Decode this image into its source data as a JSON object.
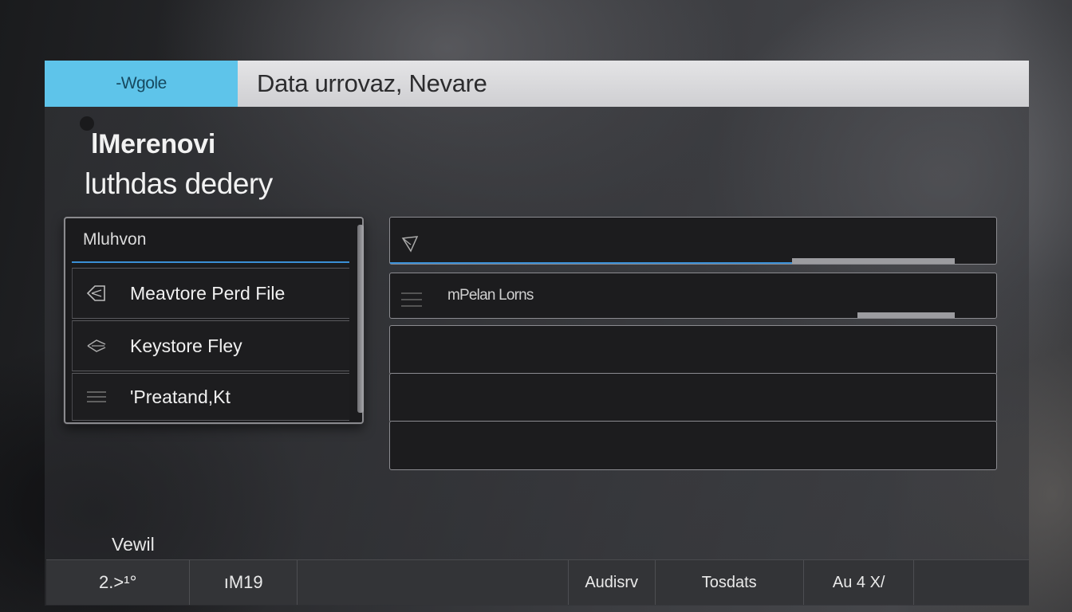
{
  "titlebar": {
    "app_tab": "-Wgole",
    "title": "Data  urrovaz, Nevare"
  },
  "heading": {
    "line1": "lMerenovi",
    "line2": "luthdas dedery"
  },
  "menu": {
    "header": "Mluhvon",
    "items": [
      {
        "label": "Meavtore Perd File",
        "icon": "tag-icon"
      },
      {
        "label": "Keystore Fley",
        "icon": "key-icon"
      },
      {
        "label": "'Preatand,Kt",
        "icon": "list-icon"
      }
    ]
  },
  "right_panel": {
    "rows": [
      {
        "text": "",
        "icon": "cursor-icon"
      },
      {
        "text": "mPelan Lorns",
        "icon": "list-icon"
      },
      {
        "text": ""
      },
      {
        "text": ""
      },
      {
        "text": ""
      }
    ]
  },
  "footer": {
    "caption": "Vewil",
    "status": [
      "2.>¹°",
      "ıM19",
      "Audisrv",
      "Tosdats",
      "Au 4 X/"
    ]
  },
  "colors": {
    "accent": "#5ec4ea",
    "focus_line": "#3a8fd6"
  }
}
